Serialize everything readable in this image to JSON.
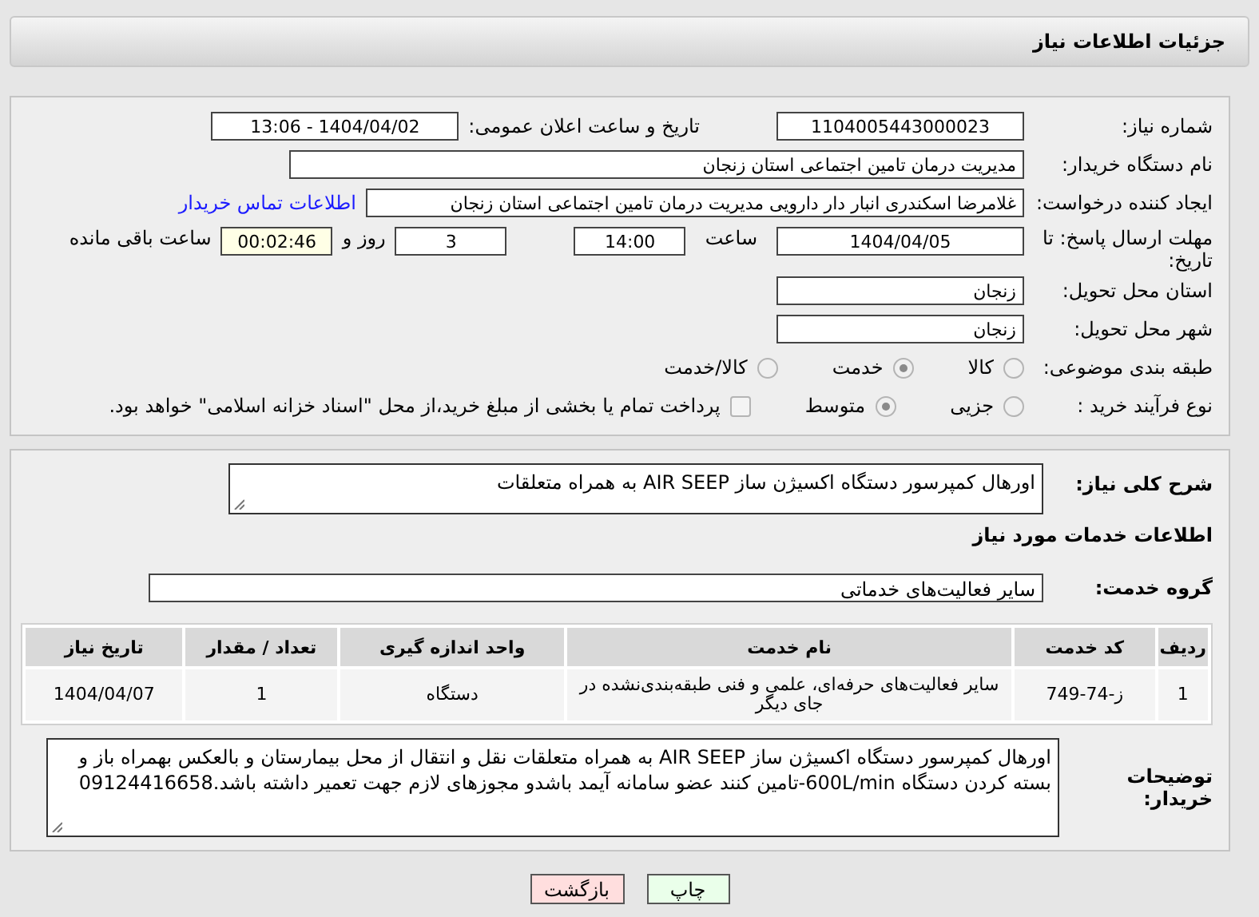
{
  "header": {
    "title": "جزئیات اطلاعات نیاز"
  },
  "need_number": {
    "label": "شماره نیاز:",
    "value": "1104005443000023"
  },
  "announce": {
    "label": "تاریخ و ساعت اعلان عمومی:",
    "value": "1404/04/02 - 13:06"
  },
  "buyer_org": {
    "label": "نام دستگاه خریدار:",
    "value": "مدیریت درمان تامین اجتماعی استان زنجان"
  },
  "requester": {
    "label": "ایجاد کننده درخواست:",
    "value": "غلامرضا  اسکندری انبار دار دارویی مدیریت درمان تامین اجتماعی استان زنجان",
    "link": "اطلاعات تماس خریدار"
  },
  "deadline": {
    "label": "مهلت ارسال پاسخ: تا تاریخ:",
    "date": "1404/04/05",
    "time_label": "ساعت",
    "time": "14:00",
    "days": "3",
    "days_label": "روز و",
    "remaining": "00:02:46",
    "remaining_label": "ساعت باقی مانده"
  },
  "province": {
    "label": "استان محل تحویل:",
    "value": "زنجان"
  },
  "city": {
    "label": "شهر محل تحویل:",
    "value": "زنجان"
  },
  "category": {
    "label": "طبقه بندی موضوعی:",
    "options": [
      {
        "label": "کالا",
        "selected": false
      },
      {
        "label": "خدمت",
        "selected": true
      },
      {
        "label": "کالا/خدمت",
        "selected": false
      }
    ]
  },
  "purchase_type": {
    "label": "نوع فرآیند خرید :",
    "options": [
      {
        "label": "جزیی",
        "selected": false
      },
      {
        "label": "متوسط",
        "selected": true
      }
    ],
    "payment_note": {
      "checked": false,
      "text": "پرداخت تمام یا بخشی از مبلغ خرید،از محل \"اسناد خزانه اسلامی\" خواهد بود."
    }
  },
  "summary": {
    "label": "شرح کلی نیاز:",
    "value": "اورهال کمپرسور دستگاه اکسیژن ساز AIR SEEP به همراه متعلقات"
  },
  "services_heading": "اطلاعات خدمات مورد نیاز",
  "service_group": {
    "label": "گروه خدمت:",
    "value": "سایر فعالیت‌های خدماتی"
  },
  "table": {
    "columns": [
      "ردیف",
      "کد خدمت",
      "نام خدمت",
      "واحد اندازه گیری",
      "تعداد / مقدار",
      "تاریخ نیاز"
    ],
    "rows": [
      [
        "1",
        "ز-74-749",
        "سایر فعالیت‌های حرفه‌ای، علمی و فنی طبقه‌بندی‌نشده در جای دیگر",
        "دستگاه",
        "1",
        "1404/04/07"
      ]
    ]
  },
  "buyer_notes": {
    "label": "توضیحات خریدار:",
    "value": "اورهال کمپرسور دستگاه اکسیژن ساز AIR SEEP به همراه متعلقات نقل و انتقال از محل بیمارستان و بالعکس بهمراه باز و بسته کردن دستگاه 600L/min-تامین کنند عضو سامانه آیمد باشدو مجوزهای لازم جهت تعمیر داشته باشد.09124416658"
  },
  "buttons": [
    {
      "label": "چاپ",
      "kind": "print"
    },
    {
      "label": "بازگشت",
      "kind": "back"
    }
  ]
}
